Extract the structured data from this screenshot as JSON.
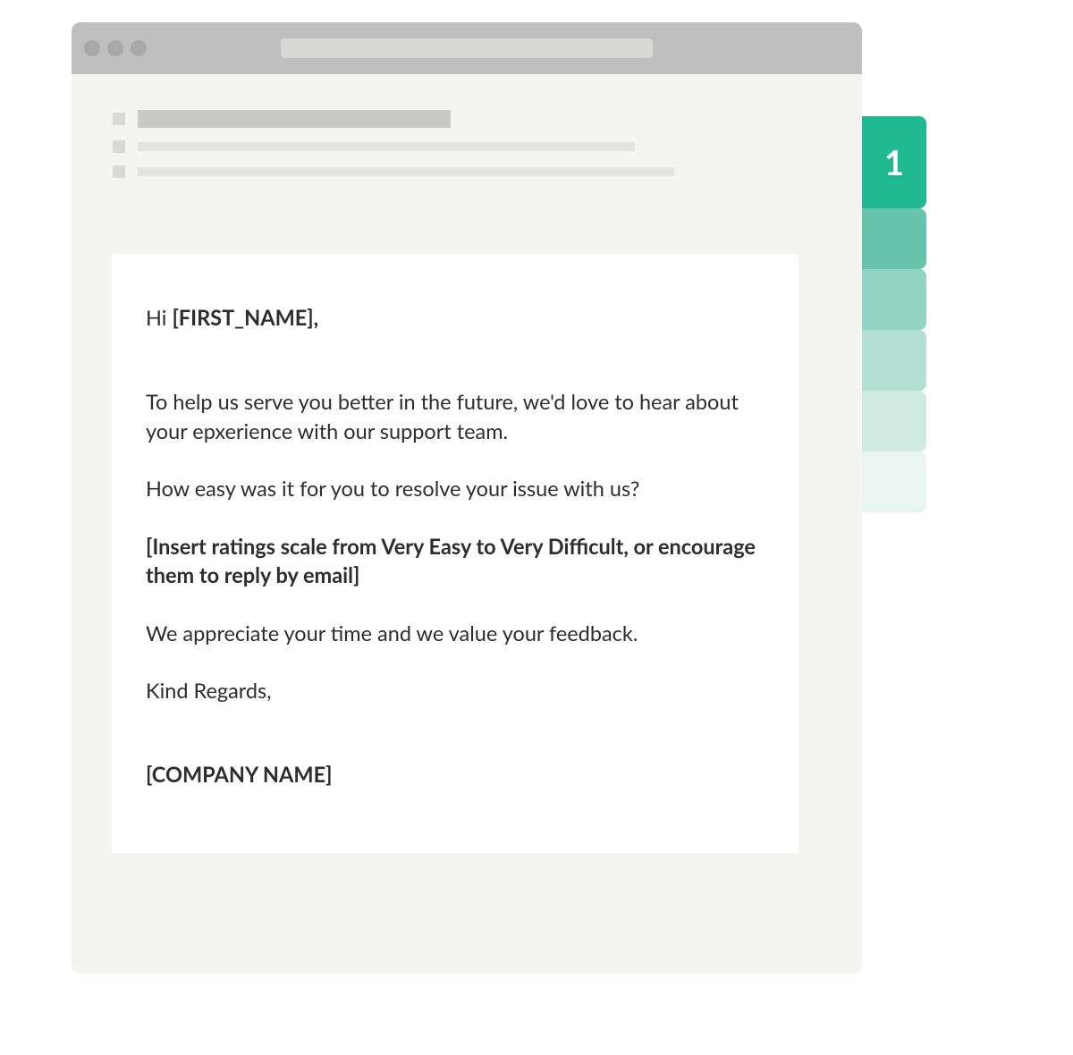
{
  "tabs": {
    "active_label": "1",
    "colors": [
      "#20b891",
      "#68c5ab",
      "#91d4c1",
      "#b3e0d3",
      "#cfeae1",
      "#e8f5f0"
    ]
  },
  "email": {
    "greeting_prefix": "Hi ",
    "greeting_name": "[FIRST_NAME],",
    "p1": "To help us serve you better in the future, we'd love to hear about your epxerience with our support team.",
    "p2": "How easy was it for you to resolve your issue with us?",
    "p3": "[Insert ratings scale from Very Easy to Very Difficult, or encourage them to reply by email]",
    "p4": "We appreciate your time and we value your feedback.",
    "signoff": "Kind Regards,",
    "company": "[COMPANY NAME]"
  }
}
